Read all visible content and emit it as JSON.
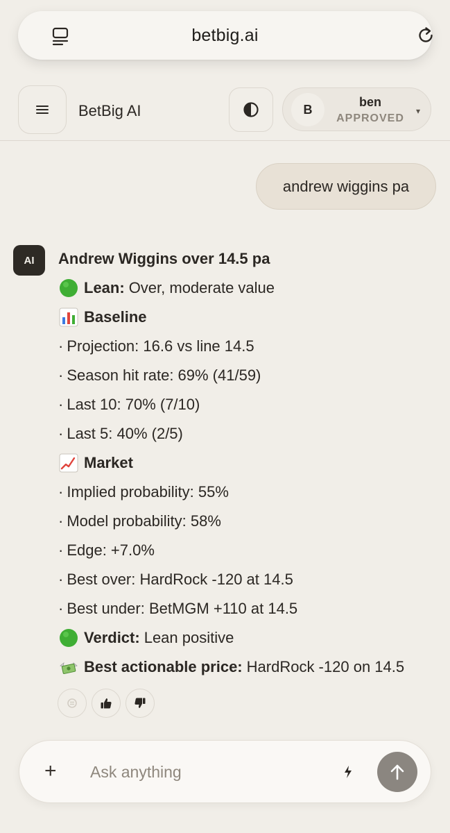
{
  "browser": {
    "url": "betbig.ai",
    "tabs_icon": "tabs-icon",
    "reload_icon": "reload-icon"
  },
  "header": {
    "menu_icon": "hamburger-icon",
    "title": "BetBig AI",
    "theme_icon": "contrast-icon",
    "user": {
      "initial": "B",
      "name": "ben",
      "status": "APPROVED",
      "chevron": "▾"
    }
  },
  "conversation": {
    "user_message": "andrew wiggins pa",
    "ai_avatar_label": "AI",
    "ai_message": {
      "title": "Andrew Wiggins over 14.5 pa",
      "lines": [
        {
          "kind": "section",
          "emoji": "green-circle",
          "label": "Lean:",
          "value": "Over, moderate value"
        },
        {
          "kind": "section",
          "emoji": "bar-chart",
          "label": "Baseline",
          "value": ""
        },
        {
          "kind": "bullet",
          "text": "Projection: 16.6 vs line 14.5"
        },
        {
          "kind": "bullet",
          "text": "Season hit rate: 69% (41/59)"
        },
        {
          "kind": "bullet",
          "text": "Last 10: 70% (7/10)"
        },
        {
          "kind": "bullet",
          "text": "Last 5: 40% (2/5)"
        },
        {
          "kind": "section",
          "emoji": "chart-increasing",
          "label": "Market",
          "value": ""
        },
        {
          "kind": "bullet",
          "text": "Implied probability: 55%"
        },
        {
          "kind": "bullet",
          "text": "Model probability: 58%"
        },
        {
          "kind": "bullet",
          "text": "Edge: +7.0%"
        },
        {
          "kind": "bullet",
          "text": "Best over: HardRock -120 at 14.5"
        },
        {
          "kind": "bullet",
          "text": "Best under: BetMGM +110 at 14.5"
        },
        {
          "kind": "section",
          "emoji": "green-circle",
          "label": "Verdict:",
          "value": "Lean positive"
        },
        {
          "kind": "section",
          "emoji": "money-with-wings",
          "label": "Best actionable price:",
          "value": "HardRock -120 on 14.5"
        }
      ],
      "bullet_char": "·"
    },
    "feedback": {
      "copy_icon": "copy-icon",
      "like_icon": "thumbs-up-icon",
      "dislike_icon": "thumbs-down-icon"
    }
  },
  "composer": {
    "placeholder": "Ask anything",
    "value": "",
    "plus_label": "+",
    "bolt_icon": "bolt-icon",
    "send_icon": "arrow-up-icon"
  },
  "colors": {
    "background": "#f1eee8",
    "user_bubble": "#e8e1d6",
    "ai_avatar": "#2e2a25",
    "send_button": "#8b8680",
    "muted_text": "#8e877d",
    "green": "#3fae34"
  }
}
